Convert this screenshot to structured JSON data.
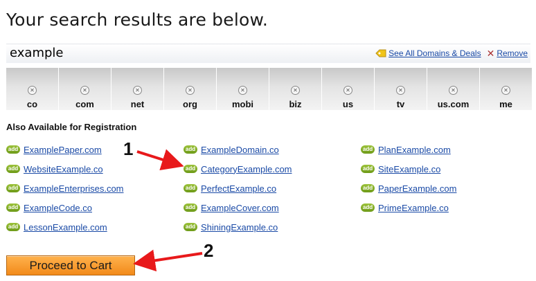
{
  "headline": "Your search results are below.",
  "query": {
    "text": "example",
    "see_all_label": "See All Domains & Deals",
    "remove_label": "Remove"
  },
  "tlds": [
    "co",
    "com",
    "net",
    "org",
    "mobi",
    "biz",
    "us",
    "tv",
    "us.com",
    "me"
  ],
  "also_available": {
    "title": "Also Available for Registration",
    "badge": "add",
    "columns": [
      [
        "ExamplePaper.com",
        "WebsiteExample.co",
        "ExampleEnterprises.com",
        "ExampleCode.co",
        "LessonExample.com"
      ],
      [
        "ExampleDomain.co",
        "CategoryExample.com",
        "PerfectExample.co",
        "ExampleCover.com",
        "ShiningExample.co"
      ],
      [
        "PlanExample.com",
        "SiteExample.co",
        "PaperExample.com",
        "PrimeExample.co"
      ]
    ]
  },
  "cart_button": "Proceed to Cart",
  "annotations": {
    "arrow1": "1",
    "arrow2": "2"
  },
  "colors": {
    "arrow": "#e8191b",
    "link": "#1a4aa6",
    "button": "#f28a1a",
    "badge": "#7da521"
  }
}
